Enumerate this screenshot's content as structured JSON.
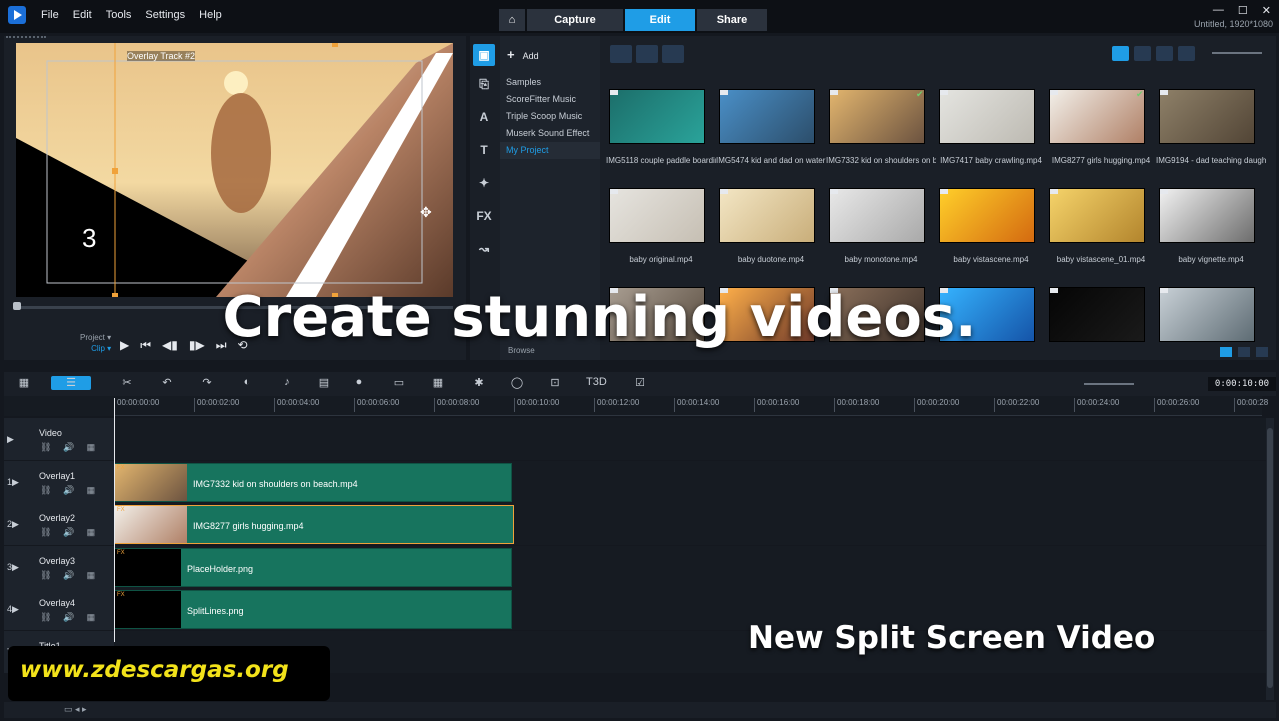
{
  "menu": [
    "File",
    "Edit",
    "Tools",
    "Settings",
    "Help"
  ],
  "modes": {
    "capture": "Capture",
    "edit": "Edit",
    "share": "Share"
  },
  "window_controls": [
    "—",
    "☐",
    "✕"
  ],
  "project_info": "Untitled, 1920*1080",
  "player": {
    "overlay_label": "Overlay Track #2",
    "countdown_number": "3",
    "project_label": "Project ▾",
    "clip_label": "Clip ▾",
    "transport": [
      "▶",
      "⏮",
      "◀▮",
      "▮▶",
      "⏭",
      "⟲"
    ]
  },
  "library": {
    "add_label": "Add",
    "folders": [
      "Samples",
      "ScoreFitter Music",
      "Triple Scoop Music",
      "Muserk Sound Effect",
      "My Project"
    ],
    "selected_folder": "My Project",
    "browse_label": "Browse",
    "side_icons": [
      "▣",
      "⎘",
      "A",
      "T",
      "✦",
      "FX",
      "↝"
    ],
    "items": [
      {
        "name": "IMG5118 couple paddle boardin...",
        "colors": [
          "#1c6e6a",
          "#2aa39a"
        ],
        "checked": false
      },
      {
        "name": "IMG5474 kid and dad on water l...",
        "colors": [
          "#4a8fc7",
          "#2c4e6b"
        ],
        "checked": false
      },
      {
        "name": "IMG7332 kid on shoulders on b...",
        "colors": [
          "#e2b56e",
          "#6c5340"
        ],
        "checked": true
      },
      {
        "name": "IMG7417 baby crawling.mp4",
        "colors": [
          "#e4e4e0",
          "#bdbab2"
        ],
        "checked": false
      },
      {
        "name": "IMG8277 girls hugging.mp4",
        "colors": [
          "#f2efe9",
          "#b08066"
        ],
        "checked": true
      },
      {
        "name": "IMG9194 - dad teaching daught...",
        "colors": [
          "#8e8068",
          "#524536"
        ],
        "checked": false
      },
      {
        "name": "baby original.mp4",
        "colors": [
          "#e6e4df",
          "#c6bfb3"
        ],
        "checked": false
      },
      {
        "name": "baby duotone.mp4",
        "colors": [
          "#f3e6c4",
          "#c9ae7a"
        ],
        "checked": false
      },
      {
        "name": "baby monotone.mp4",
        "colors": [
          "#e8e8e8",
          "#a9a9a9"
        ],
        "checked": false
      },
      {
        "name": "baby vistascene.mp4",
        "colors": [
          "#ffcf2a",
          "#d46a10"
        ],
        "checked": false
      },
      {
        "name": "baby vistascene_01.mp4",
        "colors": [
          "#f5d36a",
          "#b3852d"
        ],
        "checked": false
      },
      {
        "name": "baby vignette.mp4",
        "colors": [
          "#f1f1f1",
          "#6d6d6d"
        ],
        "checked": false
      },
      {
        "name": "",
        "colors": [
          "#a89d91",
          "#5a4d40"
        ],
        "checked": false
      },
      {
        "name": "",
        "colors": [
          "#ffb04a",
          "#703a2a"
        ],
        "checked": false
      },
      {
        "name": "",
        "colors": [
          "#8a6f5a",
          "#3c3029"
        ],
        "checked": false
      },
      {
        "name": "",
        "colors": [
          "#35b3ff",
          "#1554a8"
        ],
        "checked": false
      },
      {
        "name": "",
        "colors": [
          "#050505",
          "#1a1a1a"
        ],
        "checked": false
      },
      {
        "name": "",
        "colors": [
          "#c8d0d6",
          "#5e6c74"
        ],
        "checked": false
      }
    ]
  },
  "timeline": {
    "toolbar_icons": [
      "▦",
      "☰",
      "✂",
      "↶",
      "↷",
      "◐",
      "♪",
      "▤",
      "●",
      "▭",
      "▦",
      "✱",
      "◯",
      "⊡",
      "T3D",
      "☑"
    ],
    "timecode": "0:00:10:00",
    "ruler_ticks": [
      "00:00:00:00",
      "00:00:02:00",
      "00:00:04:00",
      "00:00:06:00",
      "00:00:08:00",
      "00:00:10:00",
      "00:00:12:00",
      "00:00:14:00",
      "00:00:16:00",
      "00:00:18:00",
      "00:00:20:00",
      "00:00:22:00",
      "00:00:24:00",
      "00:00:26:00",
      "00:00:28"
    ],
    "tracks": [
      {
        "num": "▶",
        "name": "Video"
      },
      {
        "num": "1▶",
        "name": "Overlay1"
      },
      {
        "num": "2▶",
        "name": "Overlay2"
      },
      {
        "num": "3▶",
        "name": "Overlay3"
      },
      {
        "num": "4▶",
        "name": "Overlay4"
      },
      {
        "num": "T",
        "name": "Title1"
      }
    ],
    "clips": [
      {
        "name": "IMG7332 kid on shoulders on beach.mp4",
        "colors": [
          "#e2b56e",
          "#6c5340"
        ]
      },
      {
        "name": "IMG8277 girls hugging.mp4",
        "colors": [
          "#f2efe9",
          "#b08066"
        ]
      },
      {
        "name": "PlaceHolder.png",
        "colors": [
          "#000000",
          "#000000"
        ]
      },
      {
        "name": "SplitLines.png",
        "colors": [
          "#000000",
          "#000000"
        ]
      }
    ],
    "footer_label": "▭ ◂ ▸"
  },
  "overlay_text": {
    "headline": "Create stunning videos.",
    "subheadline": "New Split Screen Video",
    "watermark": "www.zdescargas.org"
  },
  "colors": {
    "accent": "#1f9de6",
    "clip": "#17745e",
    "selected_clip": "#f0a23a",
    "watermark_text": "#f2e21a"
  }
}
